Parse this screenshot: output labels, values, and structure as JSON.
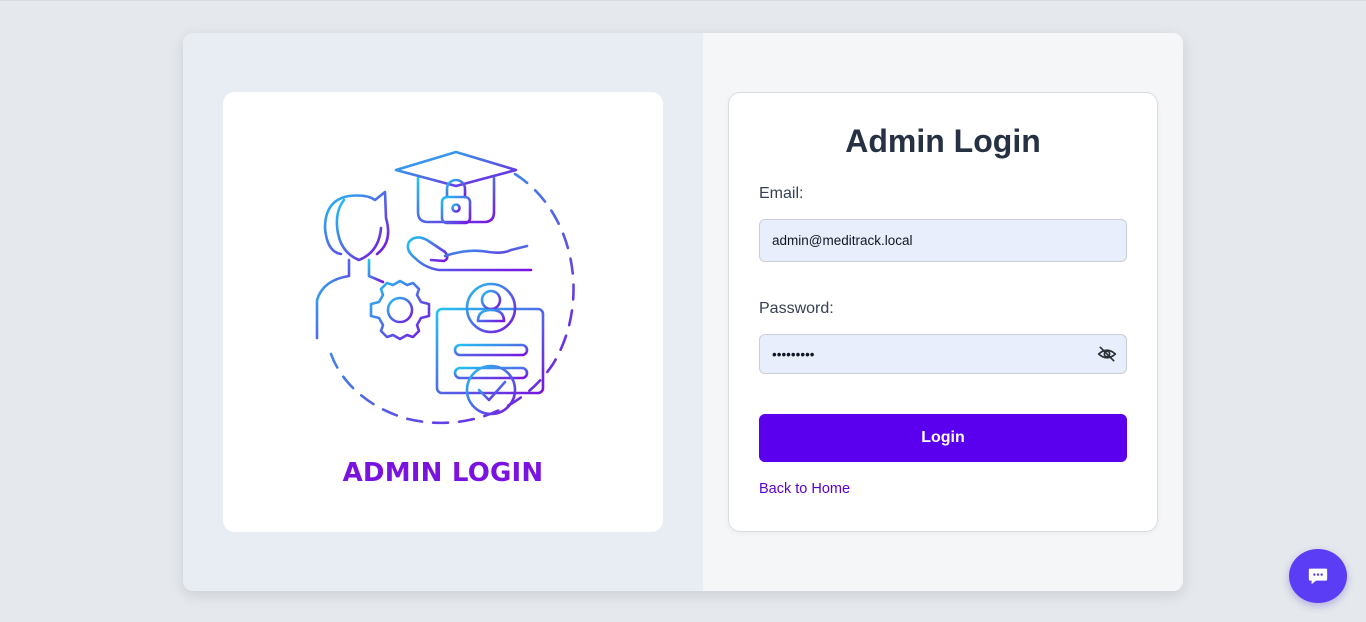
{
  "illustration": {
    "caption": "ADMIN LOGIN",
    "gradient_start": "#22c3f0",
    "gradient_end": "#7a12e0"
  },
  "form": {
    "title": "Admin Login",
    "email_label": "Email:",
    "email_value": "admin@meditrack.local",
    "password_label": "Password:",
    "password_value": "•••••••••",
    "login_label": "Login",
    "back_link": "Back to Home"
  },
  "colors": {
    "accent": "#5a00ee",
    "link": "#5a00d6",
    "input_bg": "#e8eefc",
    "chat_button": "#5a3df5"
  },
  "icons": {
    "password_toggle": "eye-off-icon",
    "chat": "chat-bubble-icon"
  }
}
